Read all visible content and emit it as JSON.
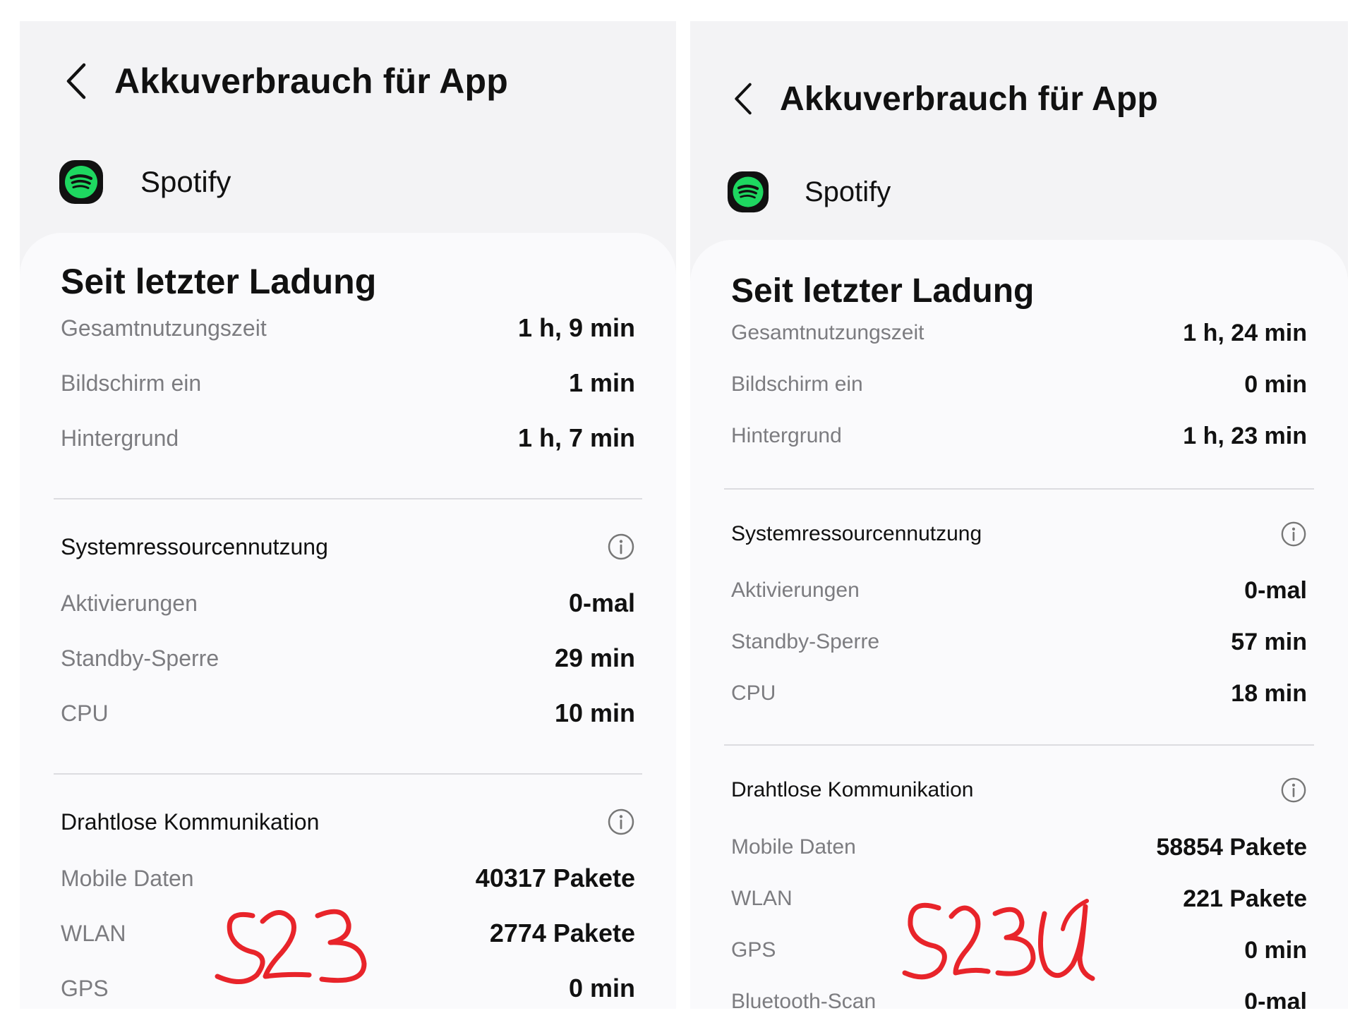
{
  "colors": {
    "spotify_green": "#1ed760",
    "icon_outline": "#111111",
    "ink_red": "#e8242a",
    "panel_bg": "#f3f3f5",
    "card_bg": "#fafafc"
  },
  "icons": {
    "back": "chevron-left-icon",
    "app": "spotify-icon",
    "info": "info-circle-icon"
  },
  "left": {
    "header": {
      "title": "Akkuverbrauch für App"
    },
    "app": {
      "name": "Spotify"
    },
    "section_title": "Seit letzter Ladung",
    "usage": [
      {
        "label": "Gesamtnutzungszeit",
        "value": "1 h, 9 min"
      },
      {
        "label": "Bildschirm ein",
        "value": "1 min"
      },
      {
        "label": "Hintergrund",
        "value": "1 h, 7 min"
      }
    ],
    "system": {
      "title": "Systemressourcennutzung",
      "items": [
        {
          "label": "Aktivierungen",
          "value": "0-mal"
        },
        {
          "label": "Standby-Sperre",
          "value": "29 min"
        },
        {
          "label": "CPU",
          "value": "10 min"
        }
      ]
    },
    "wireless": {
      "title": "Drahtlose Kommunikation",
      "items": [
        {
          "label": "Mobile Daten",
          "value": "40317 Pakete"
        },
        {
          "label": "WLAN",
          "value": "2774 Pakete"
        },
        {
          "label": "GPS",
          "value": "0 min"
        }
      ]
    },
    "annotation": "S23"
  },
  "right": {
    "header": {
      "title": "Akkuverbrauch für App"
    },
    "app": {
      "name": "Spotify"
    },
    "section_title": "Seit letzter Ladung",
    "usage": [
      {
        "label": "Gesamtnutzungszeit",
        "value": "1 h, 24 min"
      },
      {
        "label": "Bildschirm ein",
        "value": "0 min"
      },
      {
        "label": "Hintergrund",
        "value": "1 h, 23 min"
      }
    ],
    "system": {
      "title": "Systemressourcennutzung",
      "items": [
        {
          "label": "Aktivierungen",
          "value": "0-mal"
        },
        {
          "label": "Standby-Sperre",
          "value": "57 min"
        },
        {
          "label": "CPU",
          "value": "18 min"
        }
      ]
    },
    "wireless": {
      "title": "Drahtlose Kommunikation",
      "items": [
        {
          "label": "Mobile Daten",
          "value": "58854 Pakete"
        },
        {
          "label": "WLAN",
          "value": "221 Pakete"
        },
        {
          "label": "GPS",
          "value": "0 min"
        },
        {
          "label": "Bluetooth-Scan",
          "value": "0-mal"
        }
      ]
    },
    "annotation": "S23U"
  }
}
